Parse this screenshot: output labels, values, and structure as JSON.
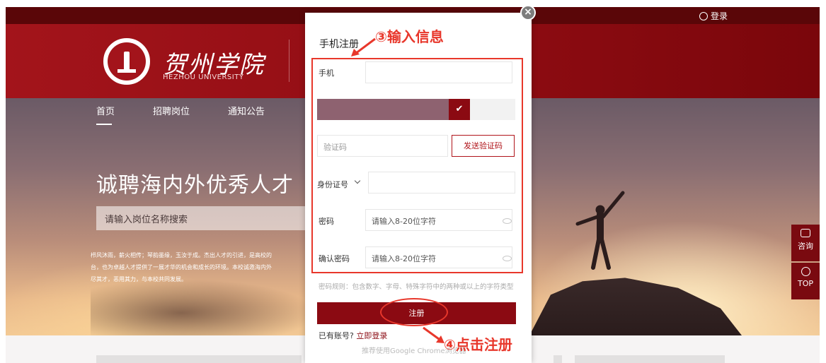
{
  "topbar": {
    "login_label": "登录"
  },
  "header": {
    "logo_cn": "贺州学院",
    "logo_en": "HEZHOU UNIVERSITY"
  },
  "nav": {
    "items": [
      {
        "label": "首页",
        "active": true
      },
      {
        "label": "招聘岗位",
        "active": false
      },
      {
        "label": "通知公告",
        "active": false
      }
    ]
  },
  "hero": {
    "title": "诚聘海内外优秀人才",
    "search_placeholder": "请输入岗位名称搜索",
    "description_lines": [
      "栉风沐雨，薪火相传；琴韵墨缘，玉汝于成。杰出人才的引进，是高校的",
      "台，也为卓越人才提供了一展才华的机会和成长的环境。本校诚邀海内外",
      "尽其才，恶用其力，与本校共同发展。"
    ]
  },
  "side_buttons": {
    "consult_label": "咨询",
    "top_label": "TOP"
  },
  "modal": {
    "title": "手机注册",
    "phone_label": "手机",
    "phone_value": "",
    "slider_check": "✔",
    "captcha_placeholder": "验证码",
    "send_code_label": "发送验证码",
    "id_type_label": "身份证号",
    "id_value": "",
    "password_label": "密码",
    "password_placeholder": "请输入8-20位字符",
    "confirm_label": "确认密码",
    "confirm_placeholder": "请输入8-20位字符",
    "password_rule": "密码规则：包含数字、字母、特殊字符中的两种或以上的字符类型",
    "register_label": "注册",
    "has_account": "已有账号?",
    "login_link": "立即登录",
    "recommend": "推荐使用Google Chrome浏览器"
  },
  "annotations": {
    "step3": "③输入信息",
    "step4": "④点击注册"
  },
  "colors": {
    "brand_red": "#8b0a12",
    "annotation_red": "#e8372b"
  }
}
